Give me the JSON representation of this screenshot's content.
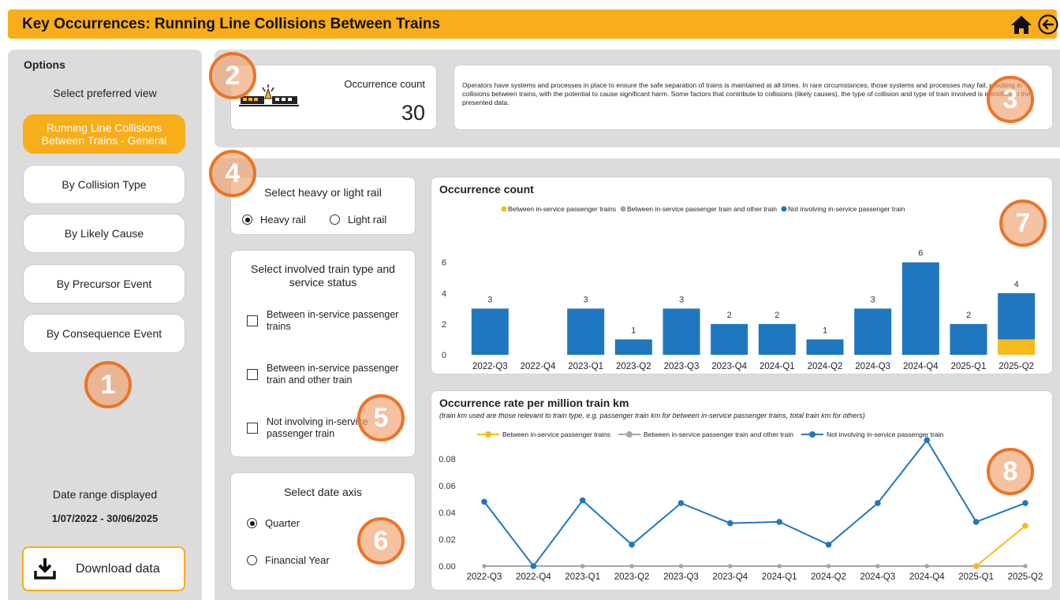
{
  "header": {
    "title": "Key Occurrences: Running Line Collisions Between Trains",
    "home_icon": "home-icon",
    "back_icon": "back-arrow-icon"
  },
  "sidebar": {
    "options_label": "Options",
    "select_view_label": "Select preferred view",
    "views": [
      {
        "label": "Running Line Collisions Between Trains - General",
        "active": true
      },
      {
        "label": "By Collision Type",
        "active": false
      },
      {
        "label": "By Likely Cause",
        "active": false
      },
      {
        "label": "By Precursor Event",
        "active": false
      },
      {
        "label": "By Consequence Event",
        "active": false
      }
    ],
    "date_range_label": "Date range displayed",
    "date_range": "1/07/2022 - 30/06/2025",
    "download_label": "Download data"
  },
  "summary": {
    "count_label": "Occurrence count",
    "count_value": "30",
    "description": "Operators have systems and processes in place to ensure the safe separation of trains is maintained at all times. In rare circumstances, those systems and processes may fail, resulting in collisions between trains, with the potential to cause significant harm. Some factors that contribute to collisions (likely causes), the type of collision and type of train involved is identified in the presented data."
  },
  "filters": {
    "rail_title": "Select heavy or light rail",
    "rail_options": [
      {
        "label": "Heavy rail",
        "selected": true
      },
      {
        "label": "Light rail",
        "selected": false
      }
    ],
    "train_type_title": "Select involved train type and service status",
    "train_types": [
      {
        "label": "Between in-service passenger trains",
        "checked": false
      },
      {
        "label": "Between in-service passenger train and other train",
        "checked": false
      },
      {
        "label": "Not involving in-service passenger train",
        "checked": false
      }
    ],
    "date_axis_title": "Select date axis",
    "date_axis_options": [
      {
        "label": "Quarter",
        "selected": true
      },
      {
        "label": "Financial Year",
        "selected": false
      }
    ]
  },
  "badges": [
    "1",
    "2",
    "3",
    "4",
    "5",
    "6",
    "7",
    "8"
  ],
  "colors": {
    "accent": "#f8ad1a",
    "blue": "#1f77bf",
    "grey": "#a6a6a6",
    "orange": "#f8b91c",
    "badge": "#ec7426"
  },
  "chart_data": [
    {
      "type": "bar",
      "title": "Occurrence count",
      "categories": [
        "2022-Q3",
        "2022-Q4",
        "2023-Q1",
        "2023-Q2",
        "2023-Q3",
        "2023-Q4",
        "2024-Q1",
        "2024-Q2",
        "2024-Q3",
        "2024-Q4",
        "2025-Q1",
        "2025-Q2"
      ],
      "series": [
        {
          "name": "Between in-service passenger trains",
          "color": "#f8b91c",
          "values": [
            0,
            0,
            0,
            0,
            0,
            0,
            0,
            0,
            0,
            0,
            0,
            1
          ]
        },
        {
          "name": "Between in-service passenger train and other train",
          "color": "#a6a6a6",
          "values": [
            0,
            0,
            0,
            0,
            0,
            0,
            0,
            0,
            0,
            0,
            0,
            0
          ]
        },
        {
          "name": "Not involving in-service passenger train",
          "color": "#1f77bf",
          "values": [
            3,
            0,
            3,
            1,
            3,
            2,
            2,
            1,
            3,
            6,
            2,
            3
          ]
        }
      ],
      "totals": [
        3,
        null,
        3,
        1,
        3,
        2,
        2,
        1,
        3,
        6,
        2,
        4
      ],
      "yticks": [
        0,
        2,
        4,
        6
      ],
      "ylim": [
        0,
        6.6
      ],
      "legend": "top-center"
    },
    {
      "type": "line",
      "title": "Occurrence rate per million train km",
      "subtitle": "(train km used are those relevant to train type, e.g. passenger train km for between in-service passenger trains, total train km for others)",
      "categories": [
        "2022-Q3",
        "2022-Q4",
        "2023-Q1",
        "2023-Q2",
        "2023-Q3",
        "2023-Q4",
        "2024-Q1",
        "2024-Q2",
        "2024-Q3",
        "2024-Q4",
        "2025-Q1",
        "2025-Q2"
      ],
      "series": [
        {
          "name": "Between in-service passenger trains",
          "color": "#f8b91c",
          "values": [
            null,
            null,
            null,
            null,
            null,
            null,
            null,
            null,
            null,
            null,
            0.0,
            0.03
          ]
        },
        {
          "name": "Between in-service passenger train and other train",
          "color": "#a6a6a6",
          "values": [
            0,
            0,
            0,
            0,
            0,
            0,
            0,
            0,
            0,
            0,
            0,
            0
          ]
        },
        {
          "name": "Not involving in-service passenger train",
          "color": "#1f77bf",
          "values": [
            0.048,
            0.0,
            0.049,
            0.016,
            0.047,
            0.032,
            0.033,
            0.016,
            0.047,
            0.094,
            0.033,
            0.047
          ]
        }
      ],
      "yticks": [
        "0.00",
        "0.02",
        "0.04",
        "0.06",
        "0.08"
      ],
      "ylim": [
        0,
        0.1
      ],
      "legend": "top-center"
    }
  ]
}
